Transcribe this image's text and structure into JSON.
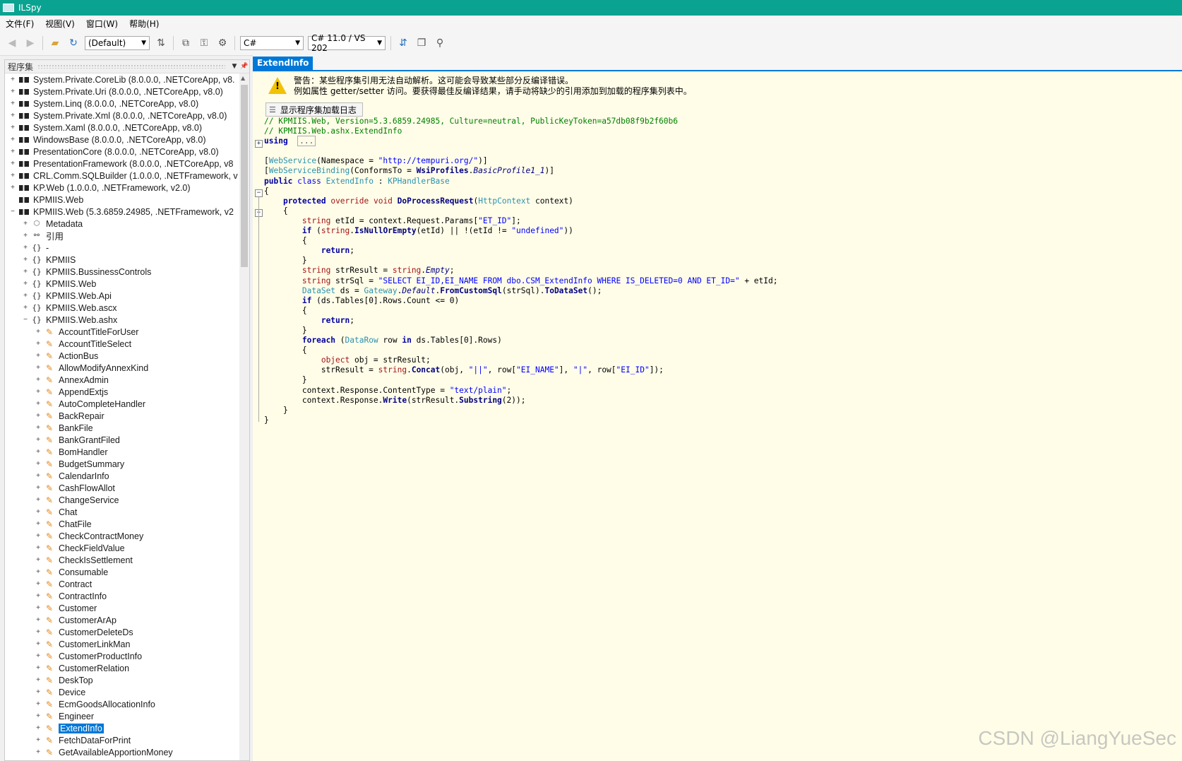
{
  "window": {
    "title": "ILSpy"
  },
  "menu": [
    "文件(F)",
    "视图(V)",
    "窗口(W)",
    "帮助(H)"
  ],
  "toolbar": {
    "profile": "(Default)",
    "language": "C#",
    "version": "C# 11.0 / VS 202"
  },
  "tree_panel": {
    "title": "程序集"
  },
  "tree": [
    {
      "label": "System.Private.CoreLib (8.0.0.0, .NETCoreApp, v8.",
      "icon": "assembly",
      "exp": "+",
      "level": 0
    },
    {
      "label": "System.Private.Uri (8.0.0.0, .NETCoreApp, v8.0)",
      "icon": "assembly",
      "exp": "+",
      "level": 0
    },
    {
      "label": "System.Linq (8.0.0.0, .NETCoreApp, v8.0)",
      "icon": "assembly",
      "exp": "+",
      "level": 0
    },
    {
      "label": "System.Private.Xml (8.0.0.0, .NETCoreApp, v8.0)",
      "icon": "assembly",
      "exp": "+",
      "level": 0
    },
    {
      "label": "System.Xaml (8.0.0.0, .NETCoreApp, v8.0)",
      "icon": "assembly",
      "exp": "+",
      "level": 0
    },
    {
      "label": "WindowsBase (8.0.0.0, .NETCoreApp, v8.0)",
      "icon": "assembly",
      "exp": "+",
      "level": 0
    },
    {
      "label": "PresentationCore (8.0.0.0, .NETCoreApp, v8.0)",
      "icon": "assembly",
      "exp": "+",
      "level": 0
    },
    {
      "label": "PresentationFramework (8.0.0.0, .NETCoreApp, v8",
      "icon": "assembly",
      "exp": "+",
      "level": 0
    },
    {
      "label": "CRL.Comm.SQLBuilder (1.0.0.0, .NETFramework, v",
      "icon": "assembly",
      "exp": "+",
      "level": 0
    },
    {
      "label": "KP.Web (1.0.0.0, .NETFramework, v2.0)",
      "icon": "assembly",
      "exp": "+",
      "level": 0
    },
    {
      "label": "KPMIIS.Web",
      "icon": "assembly",
      "exp": "",
      "level": 0
    },
    {
      "label": "KPMIIS.Web (5.3.6859.24985, .NETFramework, v2",
      "icon": "assembly",
      "exp": "−",
      "level": 0
    },
    {
      "label": "Metadata",
      "icon": "meta",
      "exp": "+",
      "level": 1
    },
    {
      "label": "引用",
      "icon": "ref",
      "exp": "+",
      "level": 1
    },
    {
      "label": "-",
      "icon": "ns",
      "exp": "+",
      "level": 1
    },
    {
      "label": "KPMIIS",
      "icon": "ns",
      "exp": "+",
      "level": 1
    },
    {
      "label": "KPMIIS.BussinessControls",
      "icon": "ns",
      "exp": "+",
      "level": 1
    },
    {
      "label": "KPMIIS.Web",
      "icon": "ns",
      "exp": "+",
      "level": 1
    },
    {
      "label": "KPMIIS.Web.Api",
      "icon": "ns",
      "exp": "+",
      "level": 1
    },
    {
      "label": "KPMIIS.Web.ascx",
      "icon": "ns",
      "exp": "+",
      "level": 1
    },
    {
      "label": "KPMIIS.Web.ashx",
      "icon": "ns",
      "exp": "−",
      "level": 1
    },
    {
      "label": "AccountTitleForUser",
      "icon": "class",
      "exp": "+",
      "level": 2
    },
    {
      "label": "AccountTitleSelect",
      "icon": "class",
      "exp": "+",
      "level": 2
    },
    {
      "label": "ActionBus",
      "icon": "class",
      "exp": "+",
      "level": 2
    },
    {
      "label": "AllowModifyAnnexKind",
      "icon": "class",
      "exp": "+",
      "level": 2
    },
    {
      "label": "AnnexAdmin",
      "icon": "class",
      "exp": "+",
      "level": 2
    },
    {
      "label": "AppendExtjs",
      "icon": "class",
      "exp": "+",
      "level": 2
    },
    {
      "label": "AutoCompleteHandler",
      "icon": "class",
      "exp": "+",
      "level": 2
    },
    {
      "label": "BackRepair",
      "icon": "class",
      "exp": "+",
      "level": 2
    },
    {
      "label": "BankFile",
      "icon": "class",
      "exp": "+",
      "level": 2
    },
    {
      "label": "BankGrantFiled",
      "icon": "class",
      "exp": "+",
      "level": 2
    },
    {
      "label": "BomHandler",
      "icon": "class",
      "exp": "+",
      "level": 2
    },
    {
      "label": "BudgetSummary",
      "icon": "class",
      "exp": "+",
      "level": 2
    },
    {
      "label": "CalendarInfo",
      "icon": "class",
      "exp": "+",
      "level": 2
    },
    {
      "label": "CashFlowAllot",
      "icon": "class",
      "exp": "+",
      "level": 2
    },
    {
      "label": "ChangeService",
      "icon": "class",
      "exp": "+",
      "level": 2
    },
    {
      "label": "Chat",
      "icon": "class",
      "exp": "+",
      "level": 2
    },
    {
      "label": "ChatFile",
      "icon": "class",
      "exp": "+",
      "level": 2
    },
    {
      "label": "CheckContractMoney",
      "icon": "class",
      "exp": "+",
      "level": 2
    },
    {
      "label": "CheckFieldValue",
      "icon": "class",
      "exp": "+",
      "level": 2
    },
    {
      "label": "CheckIsSettlement",
      "icon": "class",
      "exp": "+",
      "level": 2
    },
    {
      "label": "Consumable",
      "icon": "class",
      "exp": "+",
      "level": 2
    },
    {
      "label": "Contract",
      "icon": "class",
      "exp": "+",
      "level": 2
    },
    {
      "label": "ContractInfo",
      "icon": "class",
      "exp": "+",
      "level": 2
    },
    {
      "label": "Customer",
      "icon": "class",
      "exp": "+",
      "level": 2
    },
    {
      "label": "CustomerArAp",
      "icon": "class",
      "exp": "+",
      "level": 2
    },
    {
      "label": "CustomerDeleteDs",
      "icon": "class",
      "exp": "+",
      "level": 2
    },
    {
      "label": "CustomerLinkMan",
      "icon": "class",
      "exp": "+",
      "level": 2
    },
    {
      "label": "CustomerProductInfo",
      "icon": "class",
      "exp": "+",
      "level": 2
    },
    {
      "label": "CustomerRelation",
      "icon": "class",
      "exp": "+",
      "level": 2
    },
    {
      "label": "DeskTop",
      "icon": "class",
      "exp": "+",
      "level": 2
    },
    {
      "label": "Device",
      "icon": "class",
      "exp": "+",
      "level": 2
    },
    {
      "label": "EcmGoodsAllocationInfo",
      "icon": "class",
      "exp": "+",
      "level": 2
    },
    {
      "label": "Engineer",
      "icon": "class",
      "exp": "+",
      "level": 2
    },
    {
      "label": "ExtendInfo",
      "icon": "class",
      "exp": "+",
      "level": 2,
      "selected": true
    },
    {
      "label": "FetchDataForPrint",
      "icon": "class",
      "exp": "+",
      "level": 2
    },
    {
      "label": "GetAvailableApportionMoney",
      "icon": "class",
      "exp": "+",
      "level": 2
    }
  ],
  "editor": {
    "tab": "ExtendInfo",
    "warning_line1": "警告：某些程序集引用无法自动解析。这可能会导致某些部分反编译错误。",
    "warning_line2": "例如属性 getter/setter 访问。要获得最佳反编译结果，请手动将缺少的引用添加到加载的程序集列表中。",
    "load_log_button": "显示程序集加载日志",
    "code_lines": [
      [
        [
          "cmt",
          "// KPMIIS.Web, Version=5.3.6859.24985, Culture=neutral, PublicKeyToken=a57db08f9b2f60b6"
        ]
      ],
      [
        [
          "cmt",
          "// KPMIIS.Web.ashx.ExtendInfo"
        ]
      ],
      [
        [
          "kwb",
          "using"
        ],
        [
          "",
          "  "
        ],
        [
          "collapsed",
          "..."
        ]
      ],
      [
        [
          "",
          ""
        ]
      ],
      [
        [
          "",
          "["
        ],
        [
          "type",
          "WebService"
        ],
        [
          "",
          "(Namespace = "
        ],
        [
          "str",
          "\"http://tempuri.org/\""
        ],
        [
          "",
          ")]"
        ]
      ],
      [
        [
          "",
          "["
        ],
        [
          "type",
          "WebServiceBinding"
        ],
        [
          "",
          "(ConformsTo = "
        ],
        [
          "mth",
          "WsiProfiles"
        ],
        [
          "",
          "."
        ],
        [
          "ital",
          "BasicProfile1_1"
        ],
        [
          "",
          ")]"
        ]
      ],
      [
        [
          "kwb",
          "public"
        ],
        [
          "",
          " "
        ],
        [
          "kw",
          "class"
        ],
        [
          "",
          " "
        ],
        [
          "type",
          "ExtendInfo"
        ],
        [
          "",
          " : "
        ],
        [
          "type",
          "KPHandlerBase"
        ]
      ],
      [
        [
          "",
          "{"
        ]
      ],
      [
        [
          "",
          "    "
        ],
        [
          "kwb",
          "protected"
        ],
        [
          "",
          " "
        ],
        [
          "kwr",
          "override"
        ],
        [
          "",
          " "
        ],
        [
          "kwr",
          "void"
        ],
        [
          "",
          " "
        ],
        [
          "mth",
          "DoProcessRequest"
        ],
        [
          "",
          "("
        ],
        [
          "type",
          "HttpContext"
        ],
        [
          "",
          " context)"
        ]
      ],
      [
        [
          "",
          "    {"
        ]
      ],
      [
        [
          "",
          "        "
        ],
        [
          "kwr",
          "string"
        ],
        [
          "",
          " etId = context.Request.Params["
        ],
        [
          "str",
          "\"ET_ID\""
        ],
        [
          "",
          "];"
        ]
      ],
      [
        [
          "",
          "        "
        ],
        [
          "kwb",
          "if"
        ],
        [
          "",
          " ("
        ],
        [
          "kwr",
          "string"
        ],
        [
          "",
          "."
        ],
        [
          "mth",
          "IsNullOrEmpty"
        ],
        [
          "",
          "(etId) || !(etId != "
        ],
        [
          "str",
          "\"undefined\""
        ],
        [
          "",
          "))"
        ]
      ],
      [
        [
          "",
          "        {"
        ]
      ],
      [
        [
          "",
          "            "
        ],
        [
          "kwb",
          "return"
        ],
        [
          "",
          ";"
        ]
      ],
      [
        [
          "",
          "        }"
        ]
      ],
      [
        [
          "",
          "        "
        ],
        [
          "kwr",
          "string"
        ],
        [
          "",
          " strResult = "
        ],
        [
          "kwr",
          "string"
        ],
        [
          "",
          "."
        ],
        [
          "ital",
          "Empty"
        ],
        [
          "",
          ";"
        ]
      ],
      [
        [
          "",
          "        "
        ],
        [
          "kwr",
          "string"
        ],
        [
          "",
          " strSql = "
        ],
        [
          "str",
          "\"SELECT EI_ID,EI_NAME FROM dbo.CSM_ExtendInfo WHERE IS_DELETED=0 AND ET_ID=\""
        ],
        [
          "",
          " + etId;"
        ]
      ],
      [
        [
          "",
          "        "
        ],
        [
          "type",
          "DataSet"
        ],
        [
          "",
          " ds = "
        ],
        [
          "type",
          "Gateway"
        ],
        [
          "",
          "."
        ],
        [
          "ital",
          "Default"
        ],
        [
          "",
          "."
        ],
        [
          "mth",
          "FromCustomSql"
        ],
        [
          "",
          "(strSql)."
        ],
        [
          "mth",
          "ToDataSet"
        ],
        [
          "",
          "();"
        ]
      ],
      [
        [
          "",
          "        "
        ],
        [
          "kwb",
          "if"
        ],
        [
          "",
          " (ds.Tables[0].Rows.Count <= 0)"
        ]
      ],
      [
        [
          "",
          "        {"
        ]
      ],
      [
        [
          "",
          "            "
        ],
        [
          "kwb",
          "return"
        ],
        [
          "",
          ";"
        ]
      ],
      [
        [
          "",
          "        }"
        ]
      ],
      [
        [
          "",
          "        "
        ],
        [
          "kwb",
          "foreach"
        ],
        [
          "",
          " ("
        ],
        [
          "type",
          "DataRow"
        ],
        [
          "",
          " row "
        ],
        [
          "kwb",
          "in"
        ],
        [
          "",
          " ds.Tables[0].Rows)"
        ]
      ],
      [
        [
          "",
          "        {"
        ]
      ],
      [
        [
          "",
          "            "
        ],
        [
          "kwr",
          "object"
        ],
        [
          "",
          " obj = strResult;"
        ]
      ],
      [
        [
          "",
          "            strResult = "
        ],
        [
          "kwr",
          "string"
        ],
        [
          "",
          "."
        ],
        [
          "mth",
          "Concat"
        ],
        [
          "",
          "(obj, "
        ],
        [
          "str",
          "\"||\""
        ],
        [
          "",
          ", row["
        ],
        [
          "str",
          "\"EI_NAME\""
        ],
        [
          "",
          "], "
        ],
        [
          "str",
          "\"|\""
        ],
        [
          "",
          ", row["
        ],
        [
          "str",
          "\"EI_ID\""
        ],
        [
          "",
          "]);"
        ]
      ],
      [
        [
          "",
          "        }"
        ]
      ],
      [
        [
          "",
          "        context.Response.ContentType = "
        ],
        [
          "str",
          "\"text/plain\""
        ],
        [
          "",
          ";"
        ]
      ],
      [
        [
          "",
          "        context.Response."
        ],
        [
          "mth",
          "Write"
        ],
        [
          "",
          "(strResult."
        ],
        [
          "mth",
          "Substring"
        ],
        [
          "",
          "(2));"
        ]
      ],
      [
        [
          "",
          "    }"
        ]
      ],
      [
        [
          "",
          "}"
        ]
      ]
    ]
  },
  "watermark": "CSDN @LiangYueSec"
}
